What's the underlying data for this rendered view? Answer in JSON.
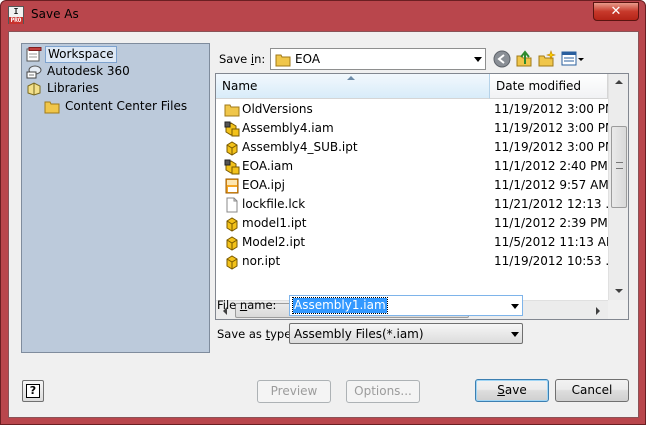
{
  "window": {
    "title": "Save As",
    "close_glyph": "✕",
    "app_icon_text": "I",
    "app_icon_badge": "PRO"
  },
  "places": [
    {
      "label": "Workspace",
      "icon": "workspace-icon",
      "selected": true
    },
    {
      "label": "Autodesk 360",
      "icon": "autodesk-360-icon",
      "selected": false
    },
    {
      "label": "Libraries",
      "icon": "libraries-icon",
      "selected": false
    },
    {
      "label": "Content Center Files",
      "icon": "folder-icon",
      "selected": false
    }
  ],
  "save_in": {
    "label_pre": "Save ",
    "label_accel": "i",
    "label_post": "n:",
    "value": "EOA"
  },
  "toolbar": {
    "back": "back-icon",
    "up": "up-folder-icon",
    "new_folder": "new-folder-icon",
    "views": "views-menu-icon"
  },
  "columns": {
    "name": "Name",
    "date": "Date modified"
  },
  "files": [
    {
      "name": "OldVersions",
      "date": "11/19/2012 3:00 PM",
      "icon": "folder-icon"
    },
    {
      "name": "Assembly4.iam",
      "date": "11/19/2012 3:00 PM",
      "icon": "assembly-file-icon"
    },
    {
      "name": "Assembly4_SUB.ipt",
      "date": "11/19/2012 3:00 PM",
      "icon": "part-file-icon"
    },
    {
      "name": "EOA.iam",
      "date": "11/1/2012 2:40 PM",
      "icon": "assembly-file-icon"
    },
    {
      "name": "EOA.ipj",
      "date": "11/1/2012 9:57 AM",
      "icon": "project-file-icon"
    },
    {
      "name": "lockfile.lck",
      "date": "11/21/2012 12:13 ...",
      "icon": "generic-file-icon"
    },
    {
      "name": "model1.ipt",
      "date": "11/1/2012 2:39 PM",
      "icon": "part-file-icon"
    },
    {
      "name": "Model2.ipt",
      "date": "11/5/2012 11:13 AM",
      "icon": "part-file-icon"
    },
    {
      "name": "nor.ipt",
      "date": "11/19/2012 10:53 ...",
      "icon": "part-file-icon"
    }
  ],
  "file_name": {
    "label_pre": "File ",
    "label_accel": "n",
    "label_post": "ame:",
    "value": "Assembly1.iam"
  },
  "save_as_type": {
    "label_pre": "Save as ",
    "label_accel": "t",
    "label_post": "ype:",
    "value": "Assembly Files(*.iam)"
  },
  "buttons": {
    "help": "?",
    "preview": "Preview",
    "options": "Options...",
    "options_accel": "O",
    "save": "Save",
    "save_accel": "S",
    "cancel": "Cancel"
  },
  "scrollbar": {
    "grip": "|||"
  }
}
